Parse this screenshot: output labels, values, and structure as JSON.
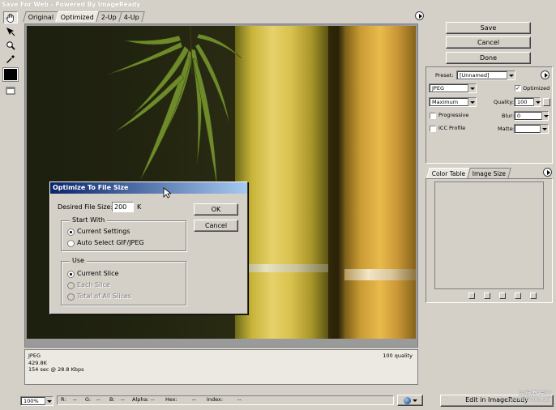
{
  "window": {
    "title": "Save For Web - Powered By ImageReady"
  },
  "tools": [
    {
      "name": "hand-tool-icon"
    },
    {
      "name": "slice-select-tool-icon"
    },
    {
      "name": "zoom-tool-icon"
    },
    {
      "name": "eyedropper-tool-icon"
    }
  ],
  "tabs": [
    "Original",
    "Optimized",
    "2-Up",
    "4-Up"
  ],
  "active_tab": "Optimized",
  "info": {
    "format": "JPEG",
    "size": "429.8K",
    "time": "154 sec @ 28.8 Kbps",
    "quality": "100 quality"
  },
  "buttons": {
    "save": "Save",
    "cancel": "Cancel",
    "done": "Done"
  },
  "settings": {
    "preset_label": "Preset:",
    "preset_value": "[Unnamed]",
    "format_value": "JPEG",
    "optimized_label": "Optimized",
    "optimized_checked": true,
    "quality_mode": "Maximum",
    "quality_label": "Quality:",
    "quality_value": "100",
    "progressive_label": "Progressive",
    "blur_label": "Blur:",
    "blur_value": "0",
    "icc_label": "ICC Profile",
    "matte_label": "Matte:"
  },
  "panel_tabs": [
    "Color Table",
    "Image Size"
  ],
  "dialog": {
    "title": "Optimize To File Size",
    "desired_label": "Desired File Size:",
    "desired_value": "200",
    "unit": "K",
    "ok": "OK",
    "cancel": "Cancel",
    "start_with": {
      "title": "Start With",
      "options": [
        "Current Settings",
        "Auto Select GIF/JPEG"
      ],
      "selected": 0
    },
    "use": {
      "title": "Use",
      "options": [
        "Current Slice",
        "Each Slice",
        "Total of All Slices"
      ],
      "selected": 0,
      "disabled": [
        1,
        2
      ]
    }
  },
  "statusbar": {
    "zoom": "100%",
    "r": "R:",
    "r_val": "--",
    "g": "G:",
    "g_val": "--",
    "b": "B:",
    "b_val": "--",
    "alpha": "Alpha:",
    "alpha_val": "--",
    "hex": "Hex:",
    "hex_val": "--",
    "index": "Index:",
    "index_val": "--",
    "edit_button": "Edit in ImageReady"
  },
  "watermark": {
    "line1": "思缘教程网",
    "line2": "www.MISSYUAN.NET"
  }
}
